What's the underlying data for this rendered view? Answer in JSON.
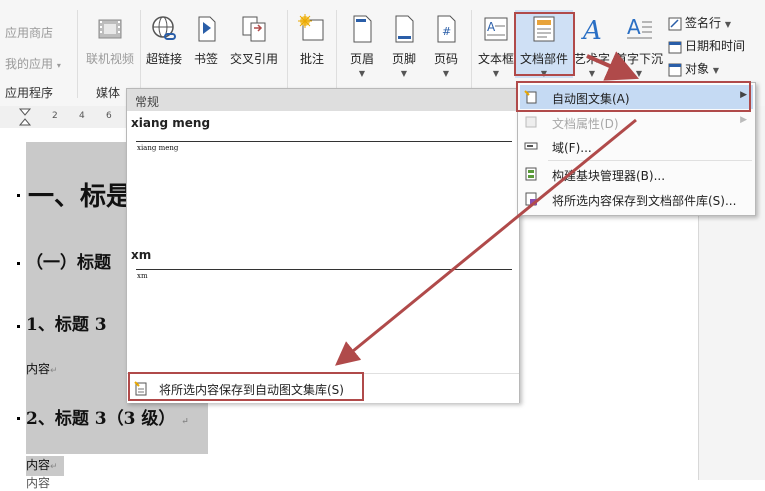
{
  "ribbon": {
    "left_group": {
      "app_store": "应用商店",
      "my_apps": "我的应用",
      "my_apps_caret": "▾",
      "apps_group_label": "应用程序"
    },
    "media": {
      "online_video": "联机视频",
      "group_label": "媒体"
    },
    "links": {
      "hyperlink": "超链接",
      "bookmark": "书签",
      "cross_ref": "交叉引用"
    },
    "comments": {
      "comment": "批注"
    },
    "header_footer": {
      "header": "页眉",
      "footer": "页脚",
      "page_number": "页码"
    },
    "text": {
      "textbox": "文本框",
      "quick_parts": "文档部件",
      "wordart": "艺术字",
      "dropcap": "首字下沉",
      "signature_line": "签名行",
      "date_time": "日期和时间",
      "object": "对象"
    }
  },
  "ruler": {
    "numbers": [
      "2",
      "4",
      "6"
    ]
  },
  "document": {
    "heading1": "一、标是",
    "heading2": "（一）标题",
    "heading3a": "1、标题 3",
    "content1": "内容",
    "heading3b": "2、标题 3（3 级）",
    "content2": "内容",
    "content3": "内容"
  },
  "gallery": {
    "section_header": "常规",
    "entries": [
      {
        "name": "xiang meng",
        "preview": "xiang meng"
      },
      {
        "name": "xm",
        "preview": "xm"
      }
    ],
    "footer_action": "将所选内容保存到自动图文集库(S)"
  },
  "menu": {
    "items": [
      {
        "label": "自动图文集(A)",
        "arrow": "▶"
      },
      {
        "label": "文档属性(D)",
        "arrow": "▶"
      },
      {
        "label": "域(F)..."
      },
      {
        "label": "构建基块管理器(B)..."
      },
      {
        "label": "将所选内容保存到文档部件库(S)..."
      }
    ]
  },
  "colors": {
    "annotation_red": "#b04a4a",
    "menu_highlight": "#c5daf3",
    "doc_highlight": "#c9c9c9"
  }
}
